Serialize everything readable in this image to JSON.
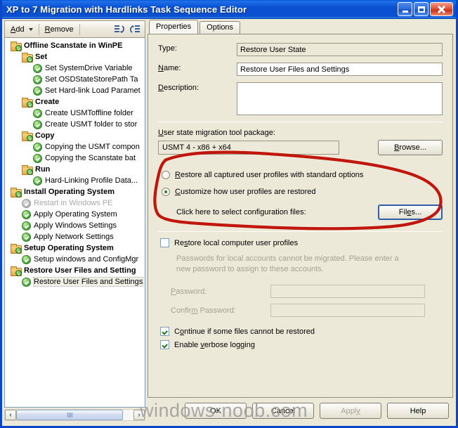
{
  "window": {
    "title": "XP to 7 Migration with Hardlinks Task Sequence Editor",
    "minimize_label": "Minimize",
    "maximize_label": "Maximize",
    "close_label": "Close"
  },
  "toolbar": {
    "add_label": "Add",
    "remove_label": "Remove",
    "icon_1": "move-up-icon",
    "icon_2": "move-down-icon"
  },
  "tree": {
    "nodes": [
      {
        "label": "Offline Scanstate in WinPE",
        "type": "folder",
        "indent": 1,
        "state": "enabled"
      },
      {
        "label": "Set",
        "type": "folder",
        "indent": 2,
        "state": "enabled"
      },
      {
        "label": "Set SystemDrive Variable",
        "type": "step",
        "indent": 3,
        "state": "enabled"
      },
      {
        "label": "Set OSDStateStorePath Ta",
        "type": "step",
        "indent": 3,
        "state": "enabled"
      },
      {
        "label": "Set Hard-link Load Paramet",
        "type": "step",
        "indent": 3,
        "state": "enabled"
      },
      {
        "label": "Create",
        "type": "folder",
        "indent": 2,
        "state": "enabled"
      },
      {
        "label": "Create USMToffline folder",
        "type": "step",
        "indent": 3,
        "state": "enabled"
      },
      {
        "label": "Create USMT folder to stor",
        "type": "step",
        "indent": 3,
        "state": "enabled"
      },
      {
        "label": "Copy",
        "type": "folder",
        "indent": 2,
        "state": "enabled"
      },
      {
        "label": "Copying the USMT compon",
        "type": "step",
        "indent": 3,
        "state": "enabled"
      },
      {
        "label": "Copying the Scanstate bat",
        "type": "step",
        "indent": 3,
        "state": "enabled"
      },
      {
        "label": "Run",
        "type": "folder",
        "indent": 2,
        "state": "enabled"
      },
      {
        "label": "Hard-Linking Profile Data...",
        "type": "step",
        "indent": 3,
        "state": "enabled"
      },
      {
        "label": "Install Operating System",
        "type": "folder",
        "indent": 1,
        "state": "enabled"
      },
      {
        "label": "Restart in Windows PE",
        "type": "step",
        "indent": 2,
        "state": "disabled"
      },
      {
        "label": "Apply Operating System",
        "type": "step",
        "indent": 2,
        "state": "enabled"
      },
      {
        "label": "Apply Windows Settings",
        "type": "step",
        "indent": 2,
        "state": "enabled"
      },
      {
        "label": "Apply Network Settings",
        "type": "step",
        "indent": 2,
        "state": "enabled"
      },
      {
        "label": "Setup Operating System",
        "type": "folder",
        "indent": 1,
        "state": "enabled"
      },
      {
        "label": "Setup windows and ConfigMgr",
        "type": "step",
        "indent": 2,
        "state": "enabled"
      },
      {
        "label": "Restore User Files and Setting",
        "type": "folder",
        "indent": 1,
        "state": "enabled"
      },
      {
        "label": "Restore User Files and Settings",
        "type": "step",
        "indent": 2,
        "state": "selected"
      }
    ],
    "hscroll": {
      "left_arrow": "‹",
      "right_arrow": "›"
    }
  },
  "tabs": [
    {
      "label": "Properties",
      "active": true
    },
    {
      "label": "Options",
      "active": false
    }
  ],
  "properties": {
    "type_label": "Type:",
    "type_value": "Restore User State",
    "name_label": "Name:",
    "name_label_accel": "N",
    "name_value": "Restore User Files and Settings",
    "description_label": "Description:",
    "description_label_accel": "D",
    "description_value": "",
    "package_label": "User state migration tool package:",
    "package_label_accel": "U",
    "package_value": "USMT 4 - x86 + x64",
    "browse_label": "Browse...",
    "browse_accel": "B",
    "radio_standard_label": "Restore all captured user profiles with standard options",
    "radio_standard_accel": "R",
    "radio_standard_selected": false,
    "radio_custom_label": "Customize how user profiles are restored",
    "radio_custom_accel": "C",
    "radio_custom_selected": true,
    "config_files_label": "Click here to select configuration files:",
    "files_button_label": "Files...",
    "files_button_accel": "e",
    "restore_local_label": "Restore local computer user profiles",
    "restore_local_accel": "s",
    "restore_local_checked": false,
    "password_hint": "Passwords for local accounts cannot be migrated. Please enter a new password to assign to these accounts.",
    "password_label": "Password:",
    "password_accel": "P",
    "password_value": "",
    "confirm_password_label": "Confirm Password:",
    "confirm_password_accel": "m",
    "confirm_password_value": "",
    "continue_label": "Continue if some files cannot be restored",
    "continue_accel": "o",
    "continue_checked": true,
    "verbose_label": "Enable verbose logging",
    "verbose_accel": "v",
    "verbose_checked": true
  },
  "footer": {
    "ok_label": "OK",
    "cancel_label": "Cancel",
    "apply_label": "Apply",
    "apply_accel": "y",
    "apply_enabled": false,
    "help_label": "Help"
  },
  "annotation": {
    "type": "hand-drawn-ellipse",
    "color": "#c0160c",
    "target": "Customize how user profiles are restored / Files... button"
  },
  "watermark": {
    "text": "windows-noob.com",
    "color": "#9b9b9b"
  },
  "colors": {
    "titlebar_blue": "#0a50d0",
    "window_face": "#ece9d8",
    "annotation_red": "#c0160c"
  }
}
